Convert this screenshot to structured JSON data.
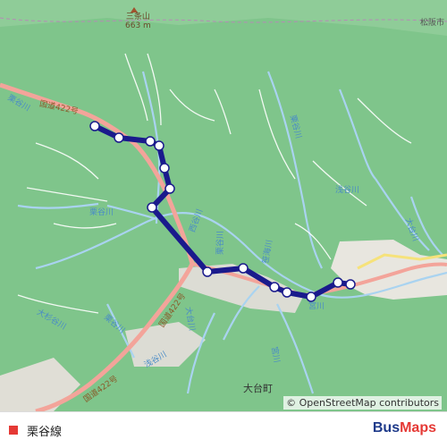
{
  "map": {
    "attribution": "© OpenStreetMap contributors",
    "peak": {
      "name": "三条山",
      "elevation": "663 m"
    },
    "labels": {
      "city_ne": "松阪市",
      "road_nw": "国道422号",
      "road_sw": "国道422号",
      "road_se": "国道422号",
      "river_kuridani_w": "栗谷川",
      "river_kuridani_c": "栗谷川",
      "river_kuridani_s": "栗谷川",
      "river_kuridani_e": "栗谷川",
      "river_asaya": "浅谷川",
      "river_sasami": "笹海川",
      "river_oomura": "大杉谷川",
      "river_nishi": "西谷川",
      "river_miyakawa": "宮川",
      "river_oodai": "大台川",
      "town": "大台町"
    },
    "colors": {
      "forest": "#7fc58b",
      "river": "#a9d3f0",
      "road_primary": "#f3a49a",
      "route_line": "#1a1a8c",
      "stop_fill": "#ffffff"
    },
    "route": {
      "stop_count": 15
    }
  },
  "footer": {
    "route_name": "栗谷線",
    "route_color": "#e53935",
    "brand_part1": "Bus",
    "brand_part2": "Maps"
  }
}
